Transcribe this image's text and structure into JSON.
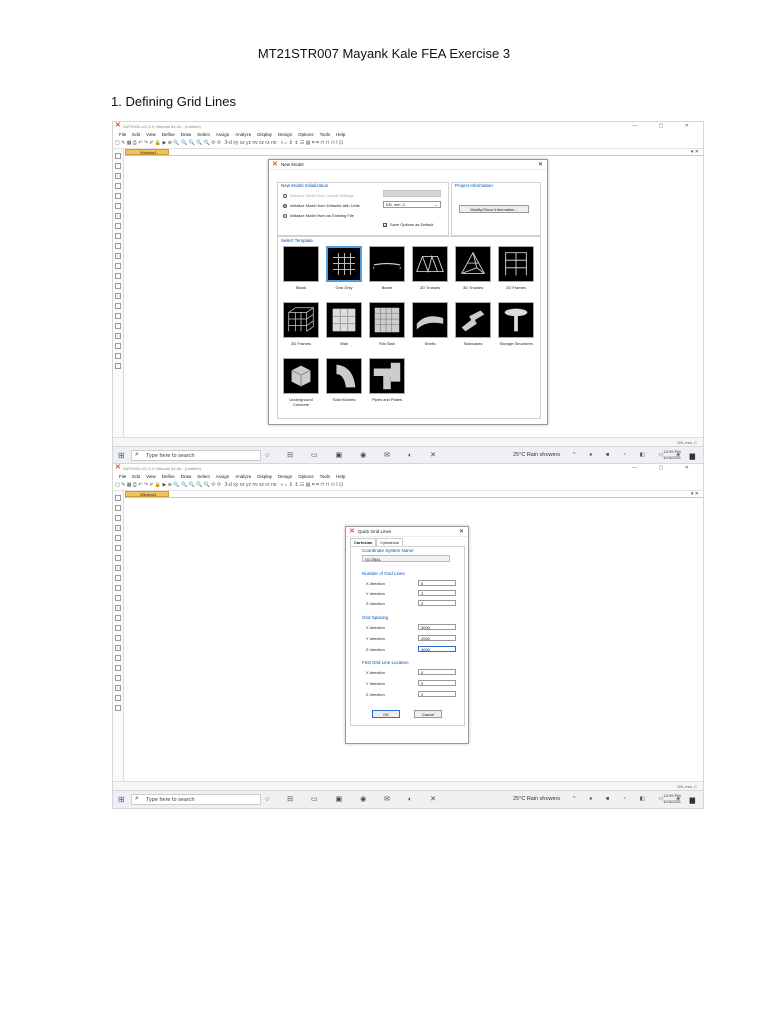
{
  "doc": {
    "title": "MT21STR007 Mayank Kale FEA Exercise 3",
    "section_heading": "1.   Defining Grid Lines"
  },
  "app": {
    "window_title": "SAP2000 v20.2.0 Ultimate 64-bit - (Untitled)",
    "menu": [
      "File",
      "Edit",
      "View",
      "Define",
      "Draw",
      "Select",
      "Assign",
      "Analyze",
      "Display",
      "Design",
      "Options",
      "Tools",
      "Help"
    ],
    "toolbar_text": "3-d  xy  xz  yz  nv  xz  rz  nn",
    "document_tab": "Window1",
    "units": "KN, mm, C",
    "win_controls": "— ▢ ✕"
  },
  "taskbar": {
    "search_placeholder": "Type here to search",
    "weather": "25°C  Rain showers",
    "time": "12:59 PM",
    "date": "10/3/2021"
  },
  "new_model": {
    "title": "New Model",
    "init_group": "New Model Initialization",
    "options": [
      {
        "label": "Initialize Model from Saved Settings",
        "selected": false,
        "disabled": true
      },
      {
        "label": "Initialize Model from Defaults with Units",
        "selected": true,
        "disabled": false
      },
      {
        "label": "Initialize Model from an Existing File",
        "selected": false,
        "disabled": false
      }
    ],
    "units_value": "KN, mm, C",
    "save_options_label": "Save Options as Default",
    "save_options_checked": true,
    "project_group": "Project Information",
    "modify_button": "Modify/Show Information...",
    "template_group": "Select Template",
    "templates": [
      {
        "label": "Blank",
        "selected": false
      },
      {
        "label": "Grid Only",
        "selected": true
      },
      {
        "label": "Beam",
        "selected": false
      },
      {
        "label": "2D Trusses",
        "selected": false
      },
      {
        "label": "3D Trusses",
        "selected": false
      },
      {
        "label": "2D Frames",
        "selected": false
      },
      {
        "label": "3D Frames",
        "selected": false
      },
      {
        "label": "Wall",
        "selected": false
      },
      {
        "label": "Flat Slab",
        "selected": false
      },
      {
        "label": "Shells",
        "selected": false
      },
      {
        "label": "Staircases",
        "selected": false
      },
      {
        "label": "Storage Structures",
        "selected": false
      },
      {
        "label": "Underground Concrete",
        "selected": false
      },
      {
        "label": "Solid Models",
        "selected": false
      },
      {
        "label": "Pipes and Plates",
        "selected": false
      }
    ]
  },
  "quick_grid": {
    "title": "Quick Grid Lines",
    "tabs": [
      "Cartesian",
      "Cylindrical"
    ],
    "coord_label": "Coordinate System Name",
    "coord_value": "GLOBAL",
    "num_group": "Number of Grid Lines",
    "num": [
      {
        "label": "X direction",
        "value": "5"
      },
      {
        "label": "Y direction",
        "value": "3"
      },
      {
        "label": "Z direction",
        "value": "2"
      }
    ],
    "spacing_group": "Grid Spacing",
    "spacing": [
      {
        "label": "X direction",
        "value": "3000"
      },
      {
        "label": "Y direction",
        "value": "2000"
      },
      {
        "label": "Z direction",
        "value": "4000"
      }
    ],
    "first_group": "First Grid Line Location",
    "first": [
      {
        "label": "X direction",
        "value": "0"
      },
      {
        "label": "Y direction",
        "value": "0"
      },
      {
        "label": "Z direction",
        "value": "0"
      }
    ],
    "ok": "OK",
    "cancel": "Cancel"
  }
}
